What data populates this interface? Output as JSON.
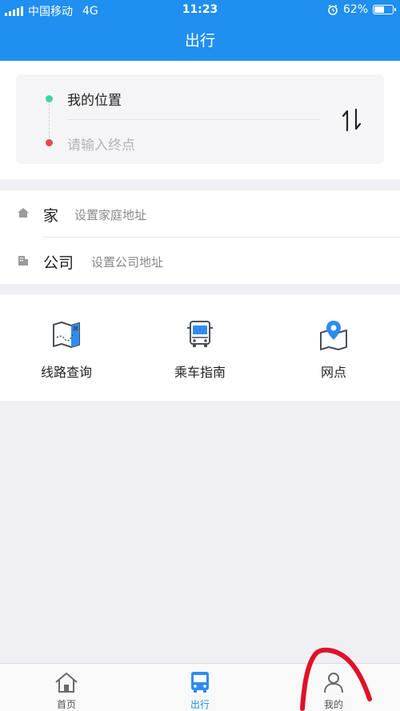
{
  "status_bar": {
    "carrier": "中国移动",
    "network": "4G",
    "time": "11:23",
    "battery": "62%",
    "battery_level": 0.62
  },
  "navbar": {
    "title": "出行"
  },
  "route": {
    "start": "我的位置",
    "end_placeholder": "请输入终点"
  },
  "places": [
    {
      "label": "家",
      "hint": "设置家庭地址"
    },
    {
      "label": "公司",
      "hint": "设置公司地址"
    }
  ],
  "tools": [
    {
      "label": "线路查询"
    },
    {
      "label": "乘车指南"
    },
    {
      "label": "网点"
    }
  ],
  "tabbar": {
    "items": [
      {
        "label": "首页"
      },
      {
        "label": "出行"
      },
      {
        "label": "我的"
      }
    ],
    "active": "出行"
  },
  "colors": {
    "primary": "#1f8ff0",
    "start_dot": "#3ed4a3",
    "end_dot": "#e8474f",
    "annotation": "#e0102a"
  }
}
